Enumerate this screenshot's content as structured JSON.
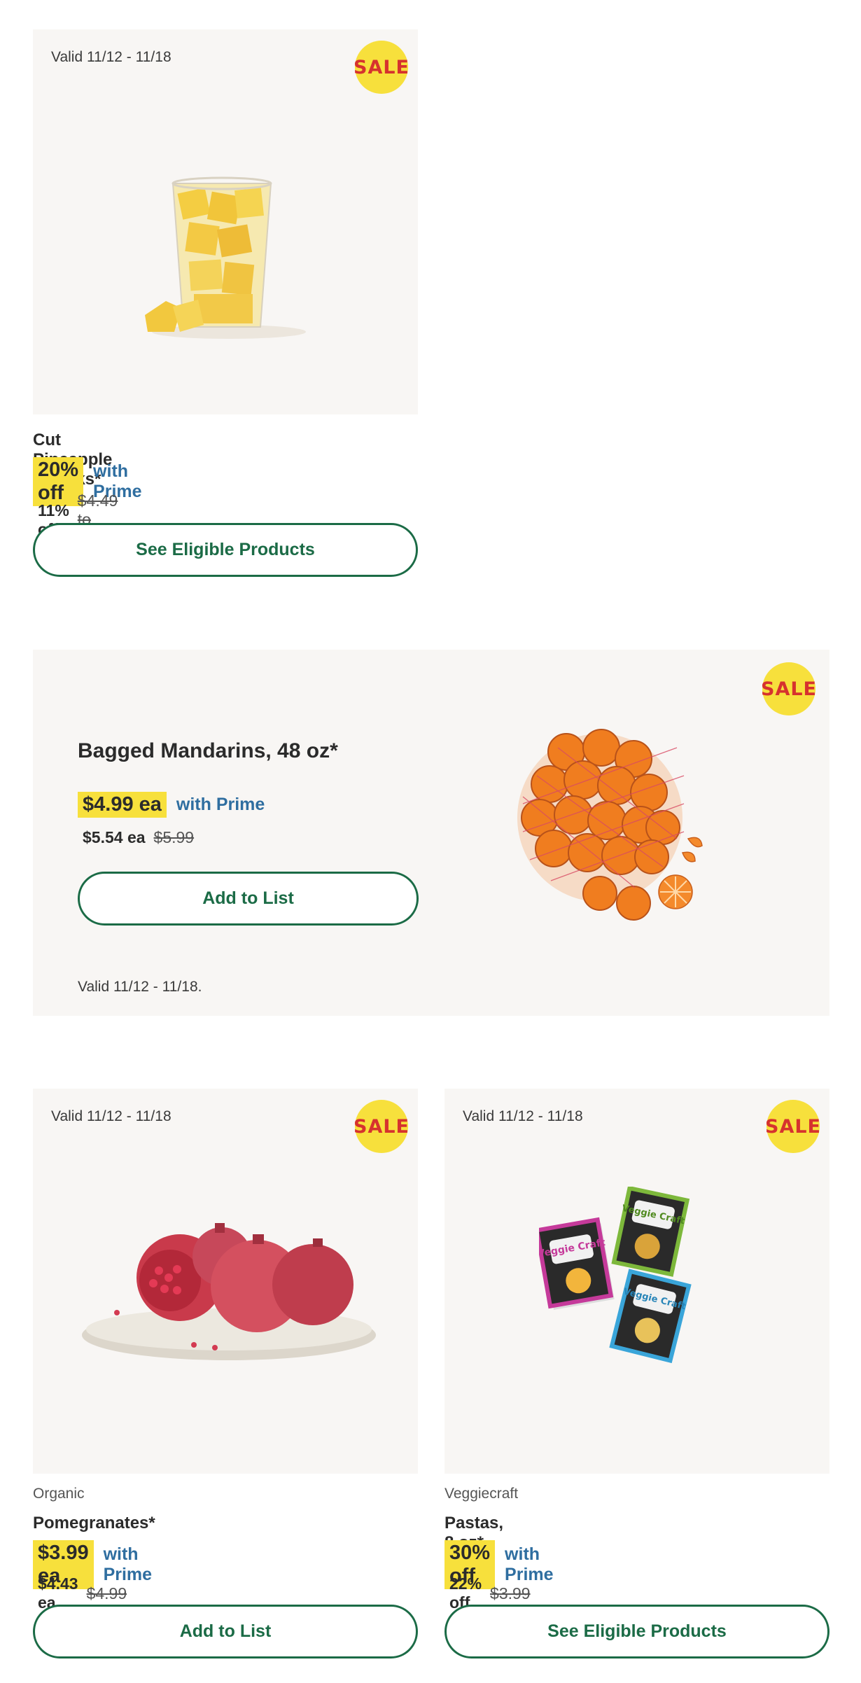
{
  "colors": {
    "sale_bg": "#f7e03c",
    "sale_text": "#d6322e",
    "prime": "#2f6ea0",
    "button": "#1b6b46",
    "tile_bg": "#f8f6f4"
  },
  "sale_label": "SALE",
  "pineapple": {
    "valid": "Valid 11/12 - 11/18",
    "title": "Cut Pineapple Chunks*",
    "promo": "20% off",
    "prime": "with Prime",
    "reg_main": "11% off",
    "reg_strike": "$4.49 to $6.49/lb",
    "button": "See Eligible Products"
  },
  "mandarins": {
    "title": "Bagged Mandarins, 48 oz*",
    "promo": "$4.99 ea",
    "prime": "with Prime",
    "reg_main": "$5.54 ea",
    "reg_strike": "$5.99",
    "button": "Add to List",
    "valid": "Valid 11/12 - 11/18."
  },
  "pomegranates": {
    "valid": "Valid 11/12 - 11/18",
    "brand": "Organic",
    "title": "Pomegranates*",
    "promo": "$3.99 ea",
    "prime": "with Prime",
    "reg_main": "$4.43 ea",
    "reg_strike": "$4.99",
    "button": "Add to List"
  },
  "pastas": {
    "valid": "Valid 11/12 - 11/18",
    "brand": "Veggiecraft",
    "title": "Pastas, 8 oz*",
    "promo": "30% off",
    "prime": "with Prime",
    "reg_main": "22% off",
    "reg_strike": "$3.99",
    "button": "See Eligible Products",
    "box_logo": "Veggie Craft"
  }
}
